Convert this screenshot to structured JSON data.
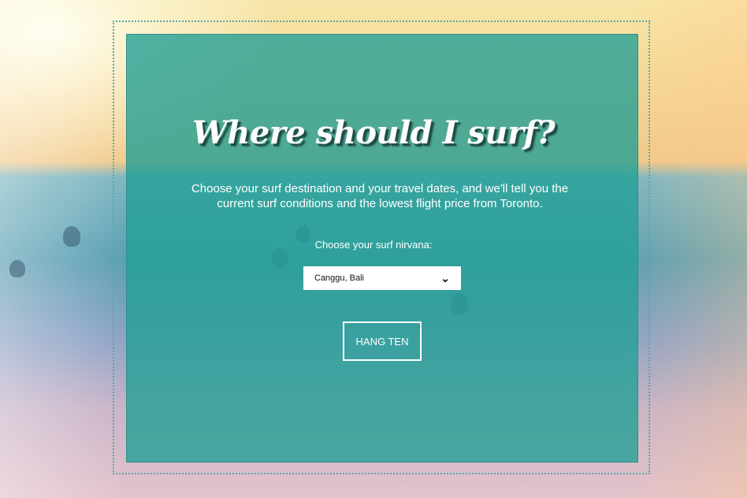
{
  "hero": {
    "title": "Where should I surf?",
    "intro": "Choose your surf destination and your travel dates, and we'll tell you the current surf conditions and the lowest flight price from Toronto.",
    "destination_label": "Choose your surf nirvana:",
    "destination_value": "Canggu, Bali",
    "submit_label": "HANG TEN"
  },
  "icons": {
    "dropdown": "chevron-down-icon"
  },
  "colors": {
    "panel": "#24a096",
    "accent": "#ffffff",
    "frame": "#59a8a2"
  }
}
